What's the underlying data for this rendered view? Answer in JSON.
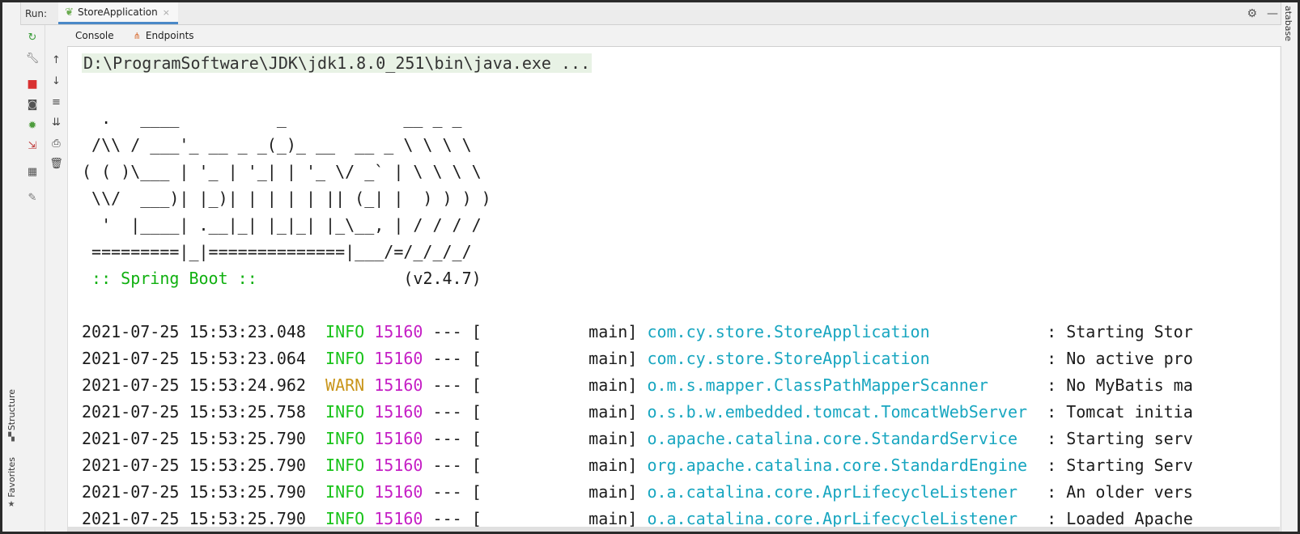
{
  "header": {
    "run_label": "Run:",
    "tab_title": "StoreApplication",
    "tab_close": "×"
  },
  "subtabs": [
    {
      "label": "Console",
      "icon": "console-icon"
    },
    {
      "label": "Endpoints",
      "icon": "endpoints-icon"
    }
  ],
  "left_stripe": {
    "structure_label": "Structure",
    "favorites_label": "Favorites"
  },
  "right_stripe": {
    "database_label": "atabase"
  },
  "console": {
    "command": "D:\\ProgramSoftware\\JDK\\jdk1.8.0_251\\bin\\java.exe ...",
    "banner": [
      "  .   ____          _            __ _ _",
      " /\\\\ / ___'_ __ _ _(_)_ __  __ _ \\ \\ \\ \\",
      "( ( )\\___ | '_ | '_| | '_ \\/ _` | \\ \\ \\ \\",
      " \\\\/  ___)| |_)| | | | | || (_| |  ) ) ) )",
      "  '  |____| .__|_| |_|_| |_\\__, | / / / /",
      " =========|_|==============|___/=/_/_/_/"
    ],
    "spring_label": " :: Spring Boot :: ",
    "spring_version": "              (v2.4.7)",
    "logs": [
      {
        "ts": "2021-07-25 15:53:23.048",
        "level": "INFO",
        "pid": "15160",
        "mid": " --- [           main] ",
        "logger": "com.cy.store.StoreApplication",
        "pad": "           ",
        "msg": " : Starting Stor"
      },
      {
        "ts": "2021-07-25 15:53:23.064",
        "level": "INFO",
        "pid": "15160",
        "mid": " --- [           main] ",
        "logger": "com.cy.store.StoreApplication",
        "pad": "           ",
        "msg": " : No active pro"
      },
      {
        "ts": "2021-07-25 15:53:24.962",
        "level": "WARN",
        "pid": "15160",
        "mid": " --- [           main] ",
        "logger": "o.m.s.mapper.ClassPathMapperScanner",
        "pad": "     ",
        "msg": " : No MyBatis ma"
      },
      {
        "ts": "2021-07-25 15:53:25.758",
        "level": "INFO",
        "pid": "15160",
        "mid": " --- [           main] ",
        "logger": "o.s.b.w.embedded.tomcat.TomcatWebServer",
        "pad": " ",
        "msg": " : Tomcat initia"
      },
      {
        "ts": "2021-07-25 15:53:25.790",
        "level": "INFO",
        "pid": "15160",
        "mid": " --- [           main] ",
        "logger": "o.apache.catalina.core.StandardService",
        "pad": "  ",
        "msg": " : Starting serv"
      },
      {
        "ts": "2021-07-25 15:53:25.790",
        "level": "INFO",
        "pid": "15160",
        "mid": " --- [           main] ",
        "logger": "org.apache.catalina.core.StandardEngine",
        "pad": " ",
        "msg": " : Starting Serv"
      },
      {
        "ts": "2021-07-25 15:53:25.790",
        "level": "INFO",
        "pid": "15160",
        "mid": " --- [           main] ",
        "logger": "o.a.catalina.core.AprLifecycleListener",
        "pad": "  ",
        "msg": " : An older vers"
      },
      {
        "ts": "2021-07-25 15:53:25.790",
        "level": "INFO",
        "pid": "15160",
        "mid": " --- [           main] ",
        "logger": "o.a.catalina.core.AprLifecycleListener",
        "pad": "  ",
        "msg": " : Loaded Apache"
      }
    ]
  },
  "colors": {
    "info": "#19c31a",
    "warn": "#c9951a",
    "pid": "#c51fc5",
    "logger": "#18a6c0",
    "spring": "#10b010"
  }
}
